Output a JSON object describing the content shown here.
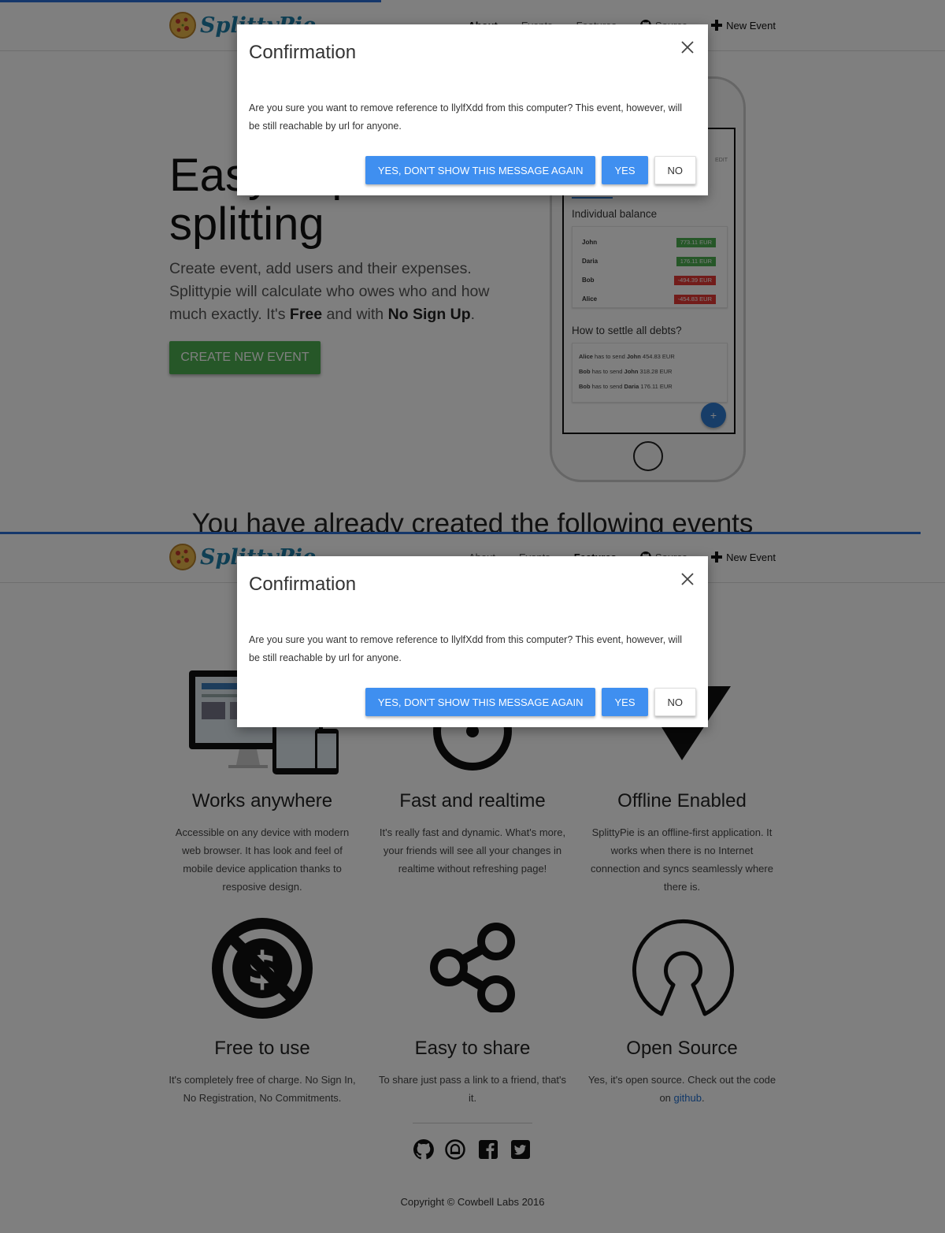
{
  "brand": {
    "name": "SplittyPie"
  },
  "nav": {
    "items": [
      {
        "label": "About"
      },
      {
        "label": "Events"
      },
      {
        "label": "Features"
      },
      {
        "label": "Source"
      }
    ],
    "new_event": "New Event"
  },
  "modal": {
    "title": "Confirmation",
    "body": "Are you sure you want to remove reference to llylfXdd from this computer? This event, however, will be still reachable by url for anyone.",
    "btn_dont_show": "YES, DON'T SHOW THIS MESSAGE AGAIN",
    "btn_yes": "YES",
    "btn_no": "NO"
  },
  "hero": {
    "title_line1": "Easy expense",
    "title_line2": "splitting",
    "text_1": "Create event, add users and their expenses. Splittypie will calculate who owes who and how much exactly. It's ",
    "text_free": "Free",
    "text_2": " and with ",
    "text_nosignup": "No Sign Up",
    "text_3": ".",
    "cta": "CREATE NEW EVENT"
  },
  "phone": {
    "edit_label": "EDIT",
    "balance_title": "Individual balance",
    "balances": [
      {
        "name": "John",
        "value": "773.11 EUR",
        "color": "#4caf50"
      },
      {
        "name": "Daria",
        "value": "176.11 EUR",
        "color": "#4caf50"
      },
      {
        "name": "Bob",
        "value": "-494.39 EUR",
        "color": "#e53935"
      },
      {
        "name": "Alice",
        "value": "-454.83 EUR",
        "color": "#e53935"
      }
    ],
    "settle_title": "How to settle all debts?",
    "debts": [
      {
        "from": "Alice",
        "mid": " has to send ",
        "to": "John",
        "amount": " 454.83 EUR"
      },
      {
        "from": "Bob",
        "mid": " has to send ",
        "to": "John",
        "amount": " 318.28 EUR"
      },
      {
        "from": "Bob",
        "mid": " has to send ",
        "to": "Daria",
        "amount": " 176.11 EUR"
      }
    ],
    "fab": "+"
  },
  "events_heading": "You have already created the following events",
  "features": [
    {
      "title": "Works anywhere",
      "text": "Accessible on any device with modern web browser. It has look and feel of mobile device application thanks to resposive design.",
      "icon": "devices-icon"
    },
    {
      "title": "Fast and realtime",
      "text": "It's really fast and dynamic. What's more, your friends will see all your changes in realtime without refreshing page!",
      "icon": "clock-icon"
    },
    {
      "title": "Offline Enabled",
      "text": "SplittyPie is an offline-first application. It works when there is no Internet connection and syncs seamlessly where there is.",
      "icon": "wifi-off-icon"
    },
    {
      "title": "Free to use",
      "text": "It's completely free of charge. No Sign In, No Registration, No Commitments.",
      "icon": "no-dollar-icon"
    },
    {
      "title": "Easy to share",
      "text": "To share just pass a link to a friend, that's it.",
      "icon": "share-icon"
    },
    {
      "title": "Open Source",
      "text": "Yes, it's open source. Check out the code on ",
      "link": "github",
      "text_after": ".",
      "icon": "open-source-icon"
    }
  ],
  "footer": {
    "social": [
      "github-icon",
      "bell-icon",
      "facebook-icon",
      "twitter-icon"
    ],
    "copyright": "Copyright © Cowbell Labs 2016"
  },
  "colors": {
    "primary": "#3f8ff0",
    "success": "#4caf50",
    "danger": "#e53935",
    "brand": "#1f7fa8"
  }
}
